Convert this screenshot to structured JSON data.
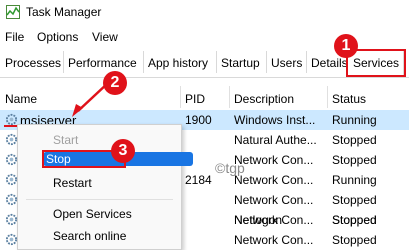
{
  "window": {
    "title": "Task Manager"
  },
  "menu": [
    "File",
    "Options",
    "View"
  ],
  "tabs": [
    "Processes",
    "Performance",
    "App history",
    "Startup",
    "Users",
    "Details",
    "Services"
  ],
  "active_tab": "Services",
  "table": {
    "headers": [
      "Name",
      "PID",
      "Description",
      "Status"
    ],
    "rows": [
      {
        "name": "msiserver",
        "pid": "1900",
        "description": "Windows Inst...",
        "status": "Running"
      },
      {
        "name": "",
        "pid": "",
        "description": "Natural Authe...",
        "status": "Stopped"
      },
      {
        "name": "",
        "pid": "",
        "description": "Network Con...",
        "status": "Stopped"
      },
      {
        "name": "",
        "pid": "2184",
        "description": "Network Con...",
        "status": "Running"
      },
      {
        "name": "",
        "pid": "",
        "description": "Network Con...",
        "status": "Stopped"
      },
      {
        "name": "",
        "pid": "",
        "description": "Network Con...",
        "status": "Stopped"
      },
      {
        "name": "",
        "pid": "",
        "description": "Netlogon",
        "status": "Stopped"
      },
      {
        "name": "",
        "pid": "",
        "description": "Network Con...",
        "status": "Stopped"
      }
    ]
  },
  "context_menu": {
    "items": [
      "Start",
      "Stop",
      "Restart",
      "Open Services",
      "Search online"
    ],
    "disabled": [
      "Start"
    ],
    "highlighted": "Stop"
  },
  "annotations": [
    "1",
    "2",
    "3"
  ],
  "watermark": "©tgp",
  "colors": {
    "accent": "#e0121a",
    "selection": "#cce8ff",
    "menu_highlight": "#1975e3"
  }
}
